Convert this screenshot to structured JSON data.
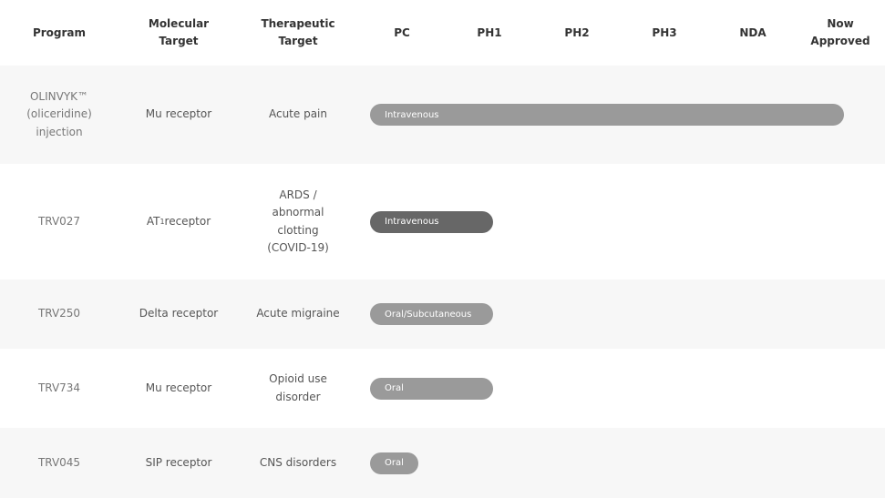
{
  "columns": [
    "Program",
    "Molecular\nTarget",
    "Therapeutic\nTarget",
    "PC",
    "PH1",
    "PH2",
    "PH3",
    "NDA",
    "Now\nApproved"
  ],
  "rows": [
    {
      "program": "OLINVYK™\n(oliceridine)\ninjection",
      "molecular_target": "Mu receptor",
      "therapeutic_target": "Acute pain",
      "route": "Intravenous",
      "stage": "Now Approved",
      "bar_color": "#9a9a9a"
    },
    {
      "program": "TRV027",
      "molecular_target": "AT1 receptor",
      "therapeutic_target": "ARDS /\nabnormal\nclotting\n(COVID-19)",
      "route": "Intravenous",
      "stage": "PH1",
      "bar_color": "#676767"
    },
    {
      "program": "TRV250",
      "molecular_target": "Delta receptor",
      "therapeutic_target": "Acute migraine",
      "route": "Oral/Subcutaneous",
      "stage": "PH1",
      "bar_color": "#9a9a9a"
    },
    {
      "program": "TRV734",
      "molecular_target": "Mu receptor",
      "therapeutic_target": "Opioid use\ndisorder",
      "route": "Oral",
      "stage": "PH1",
      "bar_color": "#9a9a9a"
    },
    {
      "program": "TRV045",
      "molecular_target": "SIP receptor",
      "therapeutic_target": "CNS disorders",
      "route": "Oral",
      "stage": "PC",
      "bar_color": "#9a9a9a"
    }
  ]
}
